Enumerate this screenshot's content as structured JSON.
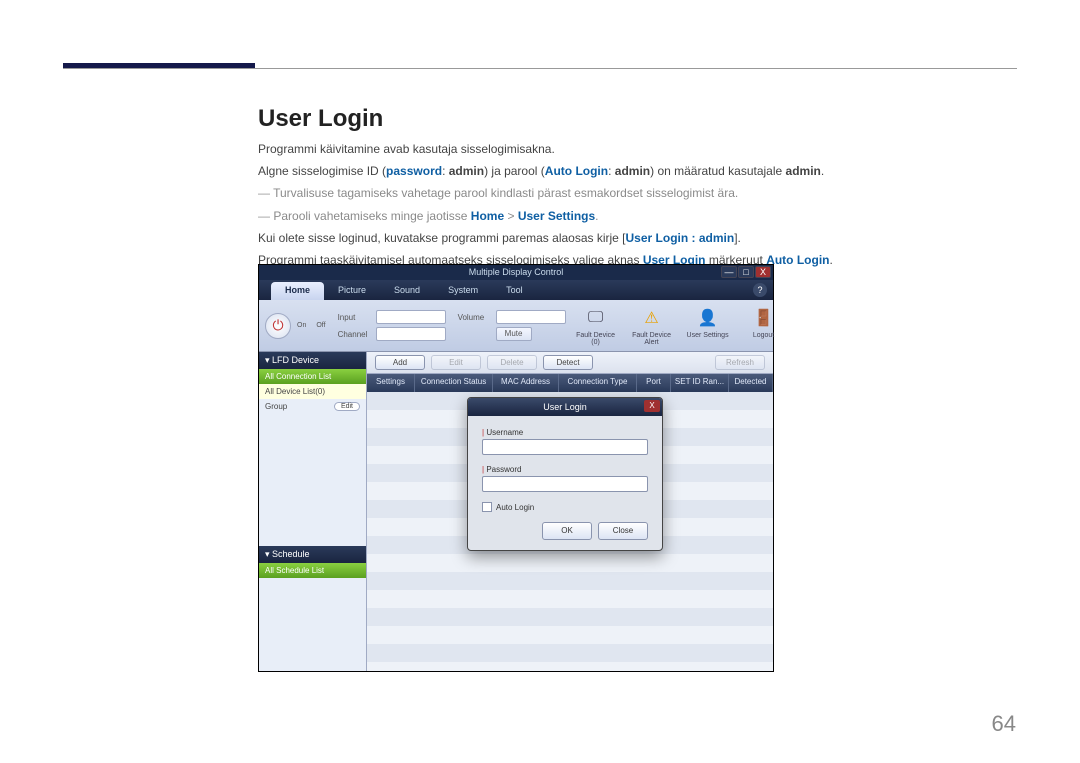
{
  "page": {
    "number": "64"
  },
  "heading": "User Login",
  "para": {
    "p1": "Programmi käivitamine avab kasutaja sisselogimisakna.",
    "p2a": "Algne sisselogimise ID (",
    "p2b": "password",
    "p2c": ": ",
    "p2d": "admin",
    "p2e": ") ja parool (",
    "p2f": "Auto Login",
    "p2g": ": ",
    "p2h": "admin",
    "p2i": ") on määratud kasutajale ",
    "p2j": "admin",
    "p2k": ".",
    "p3": "Turvalisuse tagamiseks vahetage parool kindlasti pärast esmakordset sisselogimist ära.",
    "p4a": "Parooli vahetamiseks minge jaotisse ",
    "p4b": "Home",
    "p4c": " > ",
    "p4d": "User Settings",
    "p4e": ".",
    "p5a": "Kui olete sisse loginud, kuvatakse programmi paremas alaosas kirje [",
    "p5b": "User Login : admin",
    "p5c": "].",
    "p6a": "Programmi taaskäivitamisel automaatseks sisselogimiseks valige aknas ",
    "p6b": "User Login",
    "p6c": " märkeruut ",
    "p6d": "Auto Login",
    "p6e": "."
  },
  "app": {
    "title": "Multiple Display Control",
    "win": {
      "min": "—",
      "max": "□",
      "close": "X"
    },
    "help": "?",
    "tabs": {
      "home": "Home",
      "picture": "Picture",
      "sound": "Sound",
      "system": "System",
      "tool": "Tool"
    },
    "ribbon": {
      "on": "On",
      "off": "Off",
      "input": "Input",
      "channel": "Channel",
      "volume": "Volume",
      "mute": "Mute",
      "icons": {
        "fault": "Fault Device (0)",
        "alert": "Fault Device Alert",
        "usersettings": "User Settings",
        "logout": "Logout"
      }
    },
    "side": {
      "lfd": "▾ LFD Device",
      "allconn": "All Connection List",
      "alldev": "All Device List(0)",
      "group": "Group",
      "edit": "Edit",
      "schedule": "▾ Schedule",
      "allsched": "All Schedule List"
    },
    "actions": {
      "add": "Add",
      "edit": "Edit",
      "delete": "Delete",
      "detect": "Detect",
      "refresh": "Refresh"
    },
    "cols": {
      "settings": "Settings",
      "conn": "Connection Status",
      "mac": "MAC Address",
      "type": "Connection Type",
      "port": "Port",
      "setid": "SET ID Ran...",
      "detected": "Detected"
    }
  },
  "dialog": {
    "title": "User Login",
    "username": "Username",
    "password": "Password",
    "autologin": "Auto Login",
    "ok": "OK",
    "close": "Close"
  }
}
